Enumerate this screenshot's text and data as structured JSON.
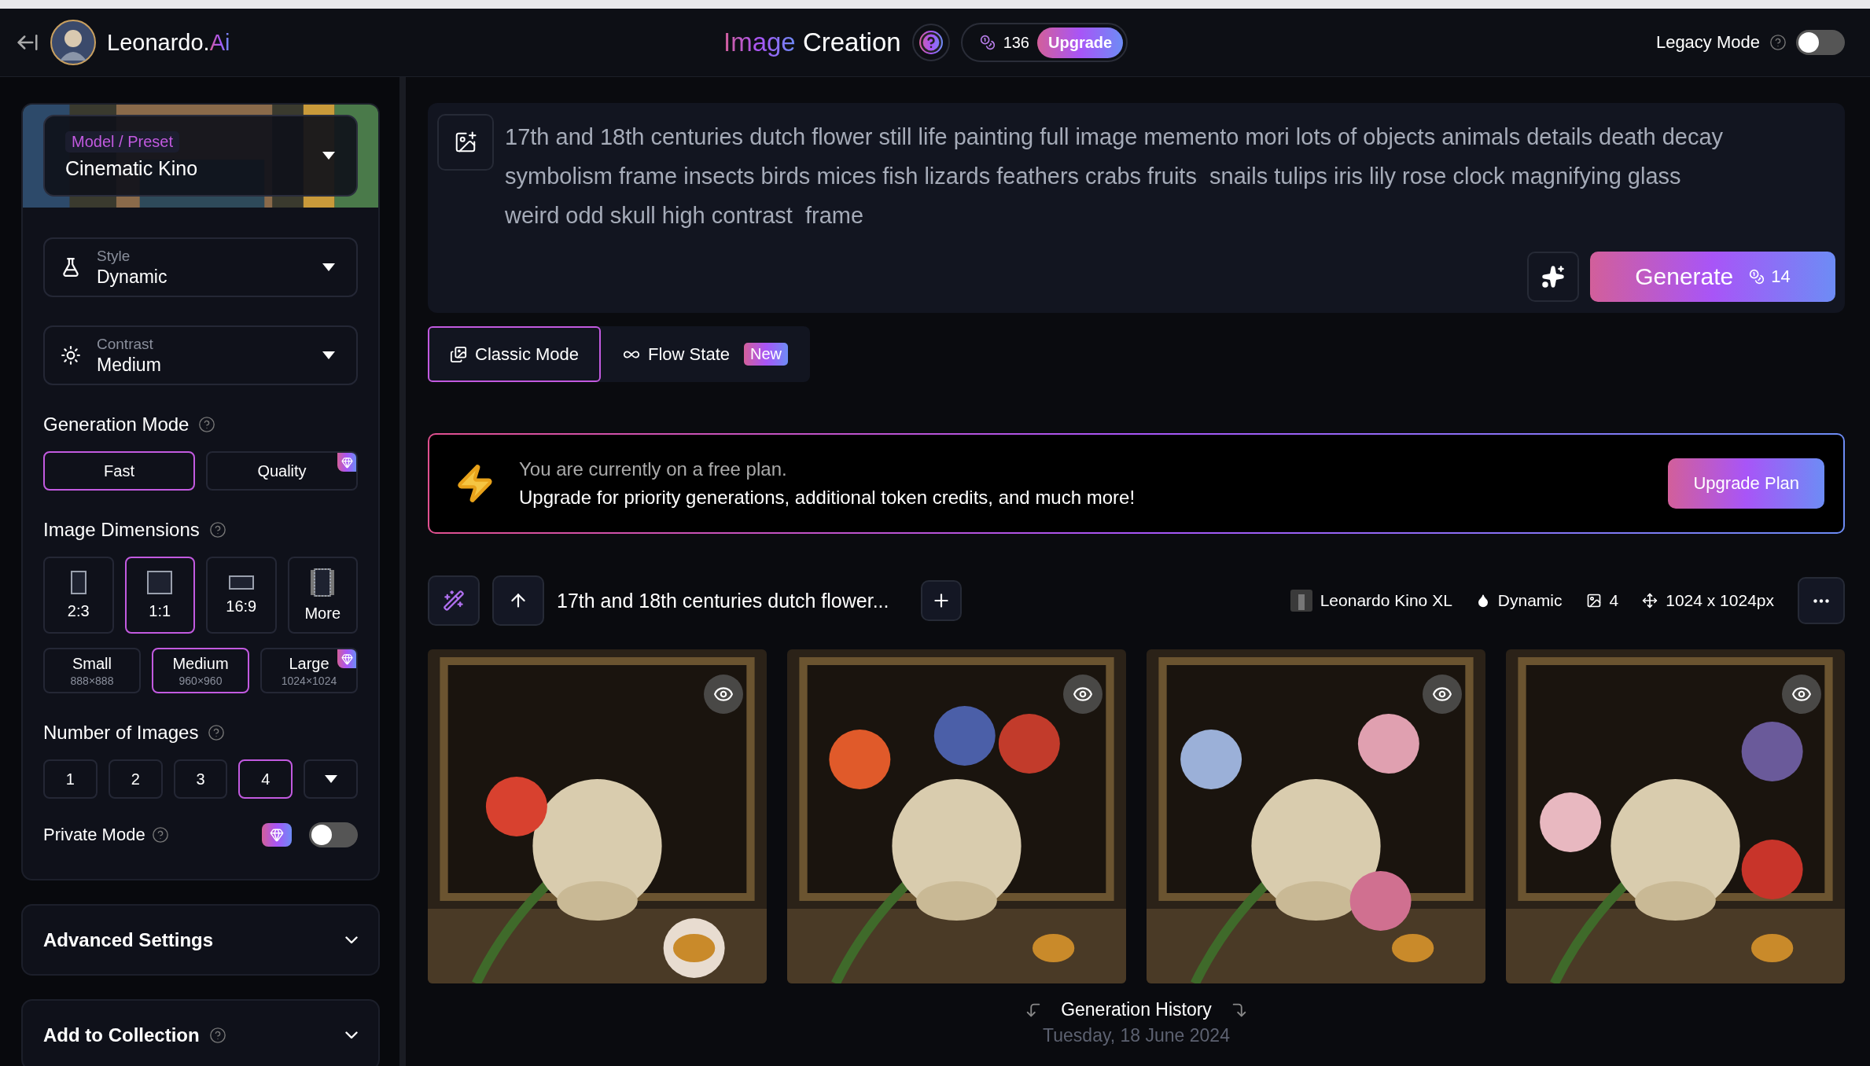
{
  "header": {
    "brand": "Leonardo.",
    "brand_accent": "Ai",
    "title_accent": "Image",
    "title": "Creation",
    "tokens": "136",
    "upgrade": "Upgrade",
    "legacy_mode": {
      "label": "Legacy Mode",
      "on": false
    }
  },
  "sidebar": {
    "model_preset": {
      "label": "Model / Preset",
      "value": "Cinematic Kino"
    },
    "selects": [
      {
        "kind": "style",
        "label": "Style",
        "value": "Dynamic"
      },
      {
        "kind": "contrast",
        "label": "Contrast",
        "value": "Medium"
      }
    ],
    "generation_mode": {
      "title": "Generation Mode",
      "options": [
        {
          "label": "Fast",
          "selected": true,
          "premium": false
        },
        {
          "label": "Quality",
          "selected": false,
          "premium": true
        }
      ]
    },
    "image_dimensions": {
      "title": "Image Dimensions",
      "ratios": [
        {
          "label": "2:3",
          "kind": "portrait",
          "selected": false
        },
        {
          "label": "1:1",
          "kind": "square",
          "selected": true
        },
        {
          "label": "16:9",
          "kind": "landscape",
          "selected": false
        },
        {
          "label": "More",
          "kind": "more",
          "selected": false
        }
      ],
      "sizes": [
        {
          "label": "Small",
          "dims": "888×888",
          "selected": false,
          "premium": false
        },
        {
          "label": "Medium",
          "dims": "960×960",
          "selected": true,
          "premium": false
        },
        {
          "label": "Large",
          "dims": "1024×1024",
          "selected": false,
          "premium": true
        }
      ]
    },
    "number_of_images": {
      "title": "Number of Images",
      "options": [
        {
          "label": "1",
          "selected": false
        },
        {
          "label": "2",
          "selected": false
        },
        {
          "label": "3",
          "selected": false
        },
        {
          "label": "4",
          "selected": true
        }
      ]
    },
    "private_mode": {
      "label": "Private Mode",
      "on": false
    },
    "sections": [
      {
        "title": "Advanced Settings",
        "help": false
      },
      {
        "title": "Add to Collection",
        "help": true
      }
    ]
  },
  "prompt": {
    "text": "17th and 18th centuries dutch flower still life painting full image memento mori lots of objects animals details death decay symbolism frame insects birds mices fish lizards feathers crabs fruits  snails tulips iris lily rose clock magnifying glass weird odd skull high contrast  frame",
    "generate": "Generate",
    "cost": "14"
  },
  "modes": [
    {
      "kind": "classic",
      "label": "Classic Mode",
      "selected": true
    },
    {
      "kind": "flow",
      "label": "Flow State",
      "badge": "New",
      "selected": false
    }
  ],
  "banner": {
    "line1": "You are currently on a free plan.",
    "line2": "Upgrade for priority generations, additional token credits, and much more!",
    "button": "Upgrade Plan"
  },
  "generation": {
    "prompt": "17th and 18th centuries dutch flower...",
    "model": "Leonardo Kino XL",
    "style": "Dynamic",
    "count": "4",
    "size": "1024 x 1024px"
  },
  "history": {
    "title": "Generation History",
    "date": "Tuesday, 18 June 2024"
  }
}
